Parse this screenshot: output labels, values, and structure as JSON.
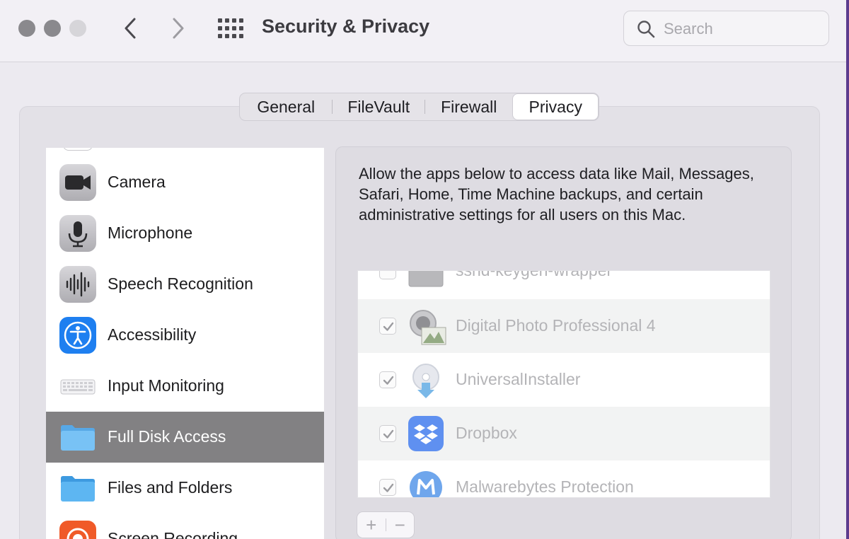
{
  "window": {
    "title": "Security & Privacy",
    "search_placeholder": "Search"
  },
  "tabs": [
    {
      "label": "General"
    },
    {
      "label": "FileVault"
    },
    {
      "label": "Firewall"
    },
    {
      "label": "Privacy",
      "selected": true
    }
  ],
  "categories": [
    {
      "label": "Camera",
      "icon": "camera-icon"
    },
    {
      "label": "Microphone",
      "icon": "microphone-icon"
    },
    {
      "label": "Speech Recognition",
      "icon": "speech-recognition-icon"
    },
    {
      "label": "Accessibility",
      "icon": "accessibility-icon"
    },
    {
      "label": "Input Monitoring",
      "icon": "keyboard-icon"
    },
    {
      "label": "Full Disk Access",
      "icon": "folder-icon",
      "selected": true
    },
    {
      "label": "Files and Folders",
      "icon": "folder-icon"
    },
    {
      "label": "Screen Recording",
      "icon": "screen-recording-icon"
    }
  ],
  "description": "Allow the apps below to access data like Mail, Messages, Safari, Home, Time Machine backups, and certain administrative settings for all users on this Mac.",
  "apps": [
    {
      "name": "sshd-keygen-wrapper",
      "checked": false,
      "icon": "terminal-icon"
    },
    {
      "name": "Digital Photo Professional 4",
      "checked": true,
      "icon": "camera-lens-icon"
    },
    {
      "name": "UniversalInstaller",
      "checked": true,
      "icon": "installer-disc-icon"
    },
    {
      "name": "Dropbox",
      "checked": true,
      "icon": "dropbox-icon"
    },
    {
      "name": "Malwarebytes Protection",
      "checked": true,
      "icon": "malwarebytes-icon"
    }
  ],
  "buttons": {
    "add": "+",
    "remove": "−"
  },
  "colors": {
    "selected_row": "#828183",
    "accessibility_blue": "#1e7ff0",
    "dropbox_blue": "#5f90f0",
    "window_edge": "#5c3c8e"
  }
}
